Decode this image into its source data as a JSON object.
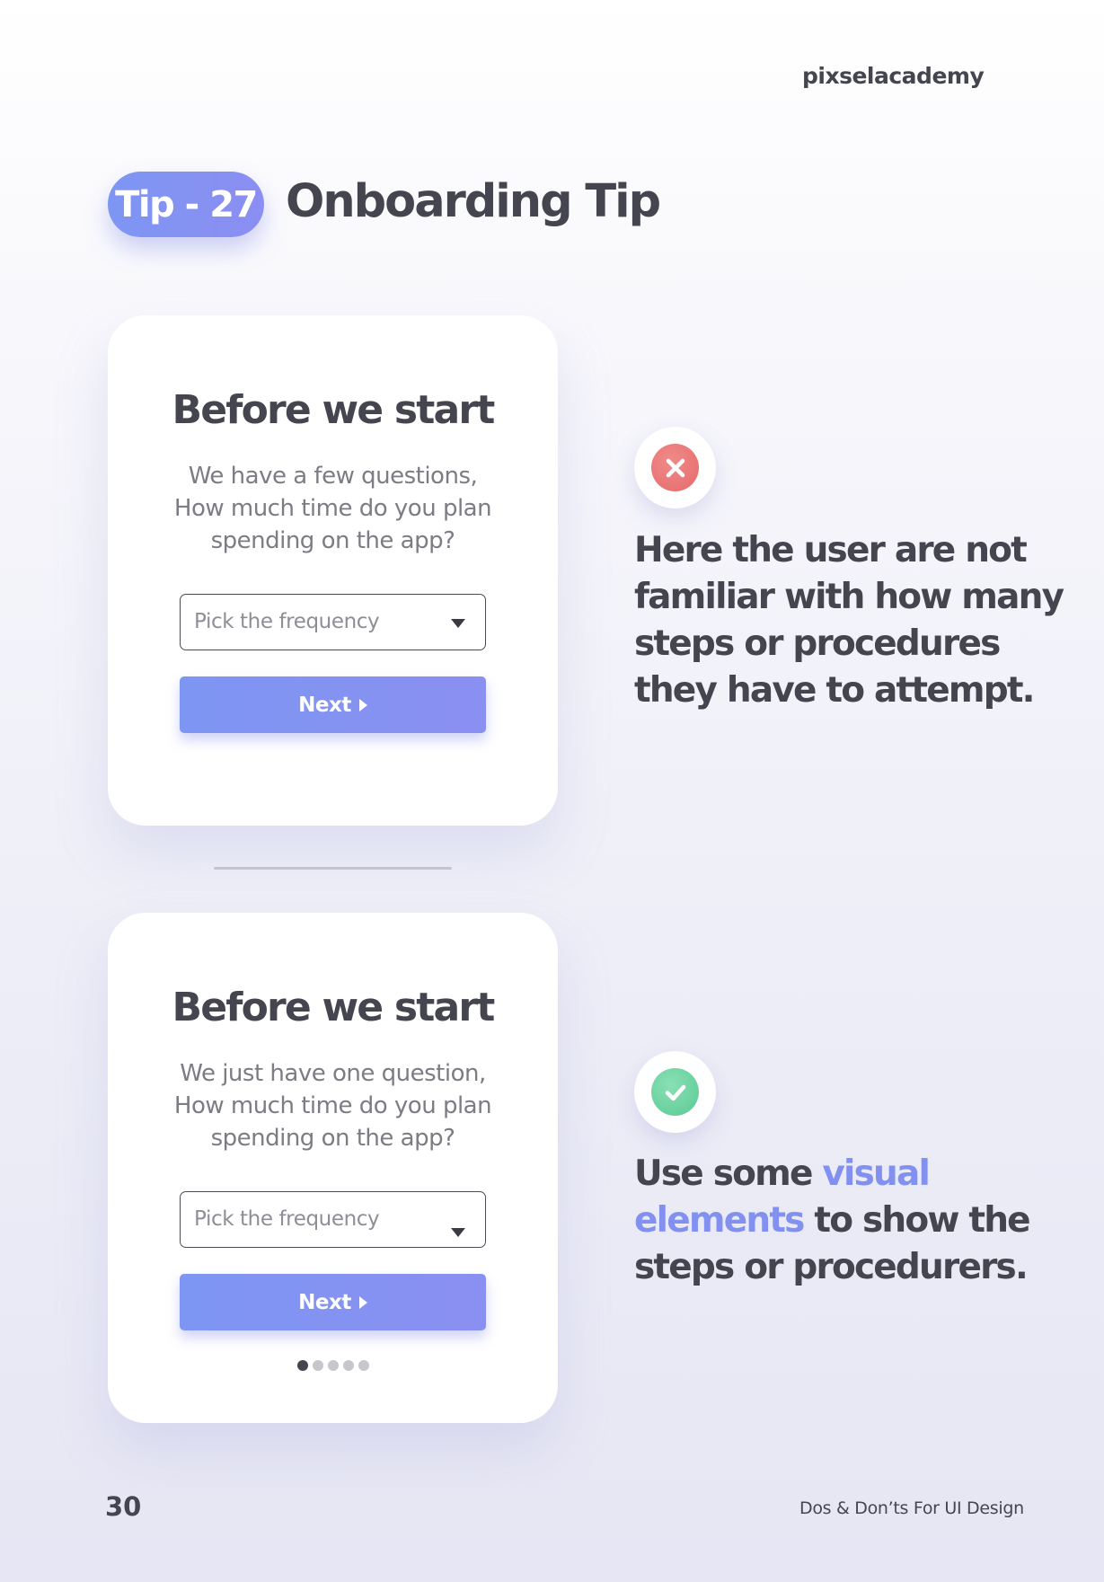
{
  "brand": "pixselacademy",
  "tip": {
    "badge": "Tip - 27",
    "title": "Onboarding Tip"
  },
  "bad_example": {
    "heading": "Before we start",
    "body_lines": [
      "We have a few questions,",
      "How much time do you plan",
      "spending on the app?"
    ],
    "select_placeholder": "Pick the frequency",
    "next_label": "Next",
    "status_icon": "close-icon",
    "status_color": "#e66a6a",
    "statement": "Here the user are not familiar with how many steps or procedures they have to attempt."
  },
  "good_example": {
    "heading": "Before we start",
    "body_lines": [
      "We just have one question,",
      "How much time do you plan",
      "spending on the app?"
    ],
    "select_placeholder": "Pick the frequency",
    "next_label": "Next",
    "progress": {
      "total_steps": 5,
      "current_step": 1
    },
    "status_icon": "check-icon",
    "status_color": "#5cc993",
    "statement_pre": "Use some ",
    "statement_accent": "visual elements",
    "statement_post": " to show the steps or procedurers."
  },
  "colors": {
    "accent": "#8291ef",
    "text": "#45454f"
  },
  "footer": {
    "page_number": "30",
    "title": "Dos & Don’ts For UI Design"
  }
}
